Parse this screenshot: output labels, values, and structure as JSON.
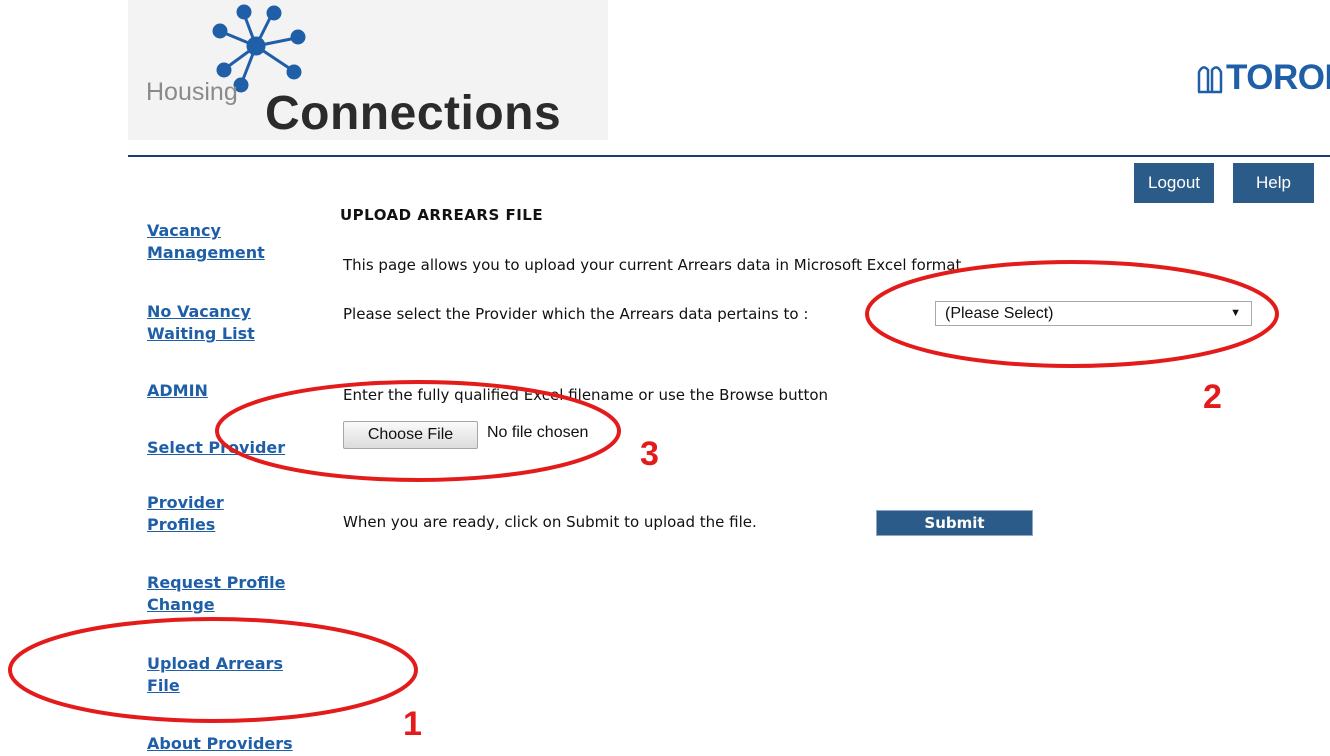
{
  "header": {
    "logo_housing": "Housing",
    "logo_connections": "Connections",
    "logo_toronto": "TORONTO",
    "brand_color": "#1f5fa8",
    "rule_color": "#1c3f66"
  },
  "top_buttons": {
    "logout": "Logout",
    "help": "Help",
    "color": "#2b5b88"
  },
  "sidebar": {
    "items": [
      {
        "line1": "Vacancy",
        "line2": "Management"
      },
      {
        "line1": "No Vacancy",
        "line2": "Waiting List"
      },
      {
        "line1": "ADMIN",
        "line2": ""
      },
      {
        "line1": "Select Provider",
        "line2": ""
      },
      {
        "line1": "Provider",
        "line2": "Profiles"
      },
      {
        "line1": "Request Profile",
        "line2": "Change"
      },
      {
        "line1": "Upload Arrears",
        "line2": "File"
      },
      {
        "line1": "About Providers",
        "line2": ""
      }
    ]
  },
  "main": {
    "title": "UPLOAD ARREARS FILE",
    "intro": "This page allows you to upload your current Arrears data in Microsoft Excel format.",
    "provider_prompt": "Please select the Provider which the Arrears data pertains to :",
    "provider_select_value": "(Please Select)",
    "file_prompt": "Enter the fully qualified Excel filename or use the Browse button",
    "file_button": "Choose File",
    "file_status": "No file chosen",
    "submit_prompt": "When you are ready, click on Submit to upload the file.",
    "submit_button": "Submit"
  },
  "annotations": {
    "color": "#e31b1b",
    "labels": [
      "1",
      "2",
      "3"
    ]
  }
}
